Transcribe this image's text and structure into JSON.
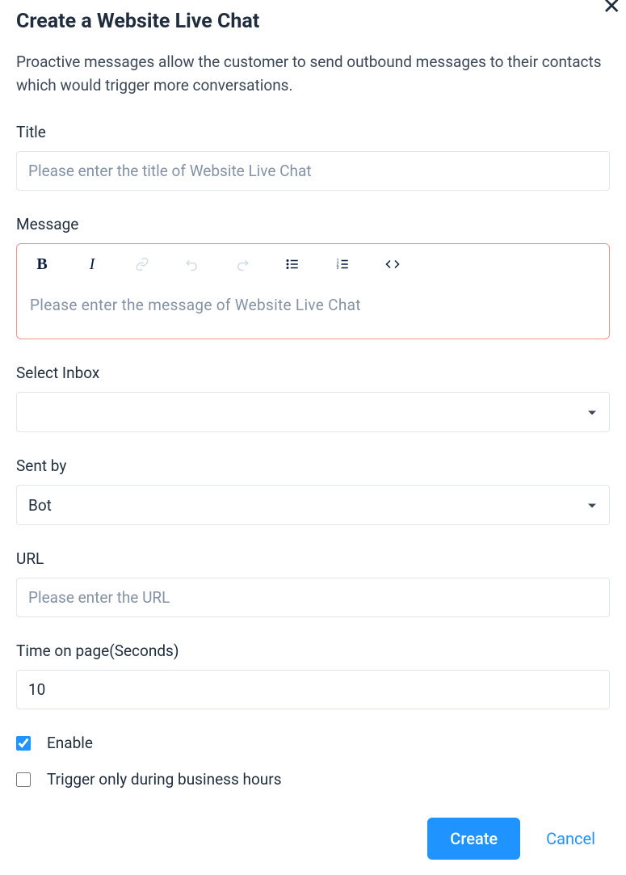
{
  "header": {
    "title": "Create a Website Live Chat",
    "description": "Proactive messages allow the customer to send outbound messages to their contacts which would trigger more conversations."
  },
  "form": {
    "title": {
      "label": "Title",
      "placeholder": "Please enter the title of Website Live Chat",
      "value": ""
    },
    "message": {
      "label": "Message",
      "placeholder": "Please enter the message of Website Live Chat"
    },
    "inbox": {
      "label": "Select Inbox",
      "value": ""
    },
    "sent_by": {
      "label": "Sent by",
      "value": "Bot"
    },
    "url": {
      "label": "URL",
      "placeholder": "Please enter the URL",
      "value": ""
    },
    "time_on_page": {
      "label": "Time on page(Seconds)",
      "value": "10"
    },
    "enable": {
      "label": "Enable",
      "checked": true
    },
    "business_hours": {
      "label": "Trigger only during business hours",
      "checked": false
    }
  },
  "buttons": {
    "create": "Create",
    "cancel": "Cancel"
  }
}
